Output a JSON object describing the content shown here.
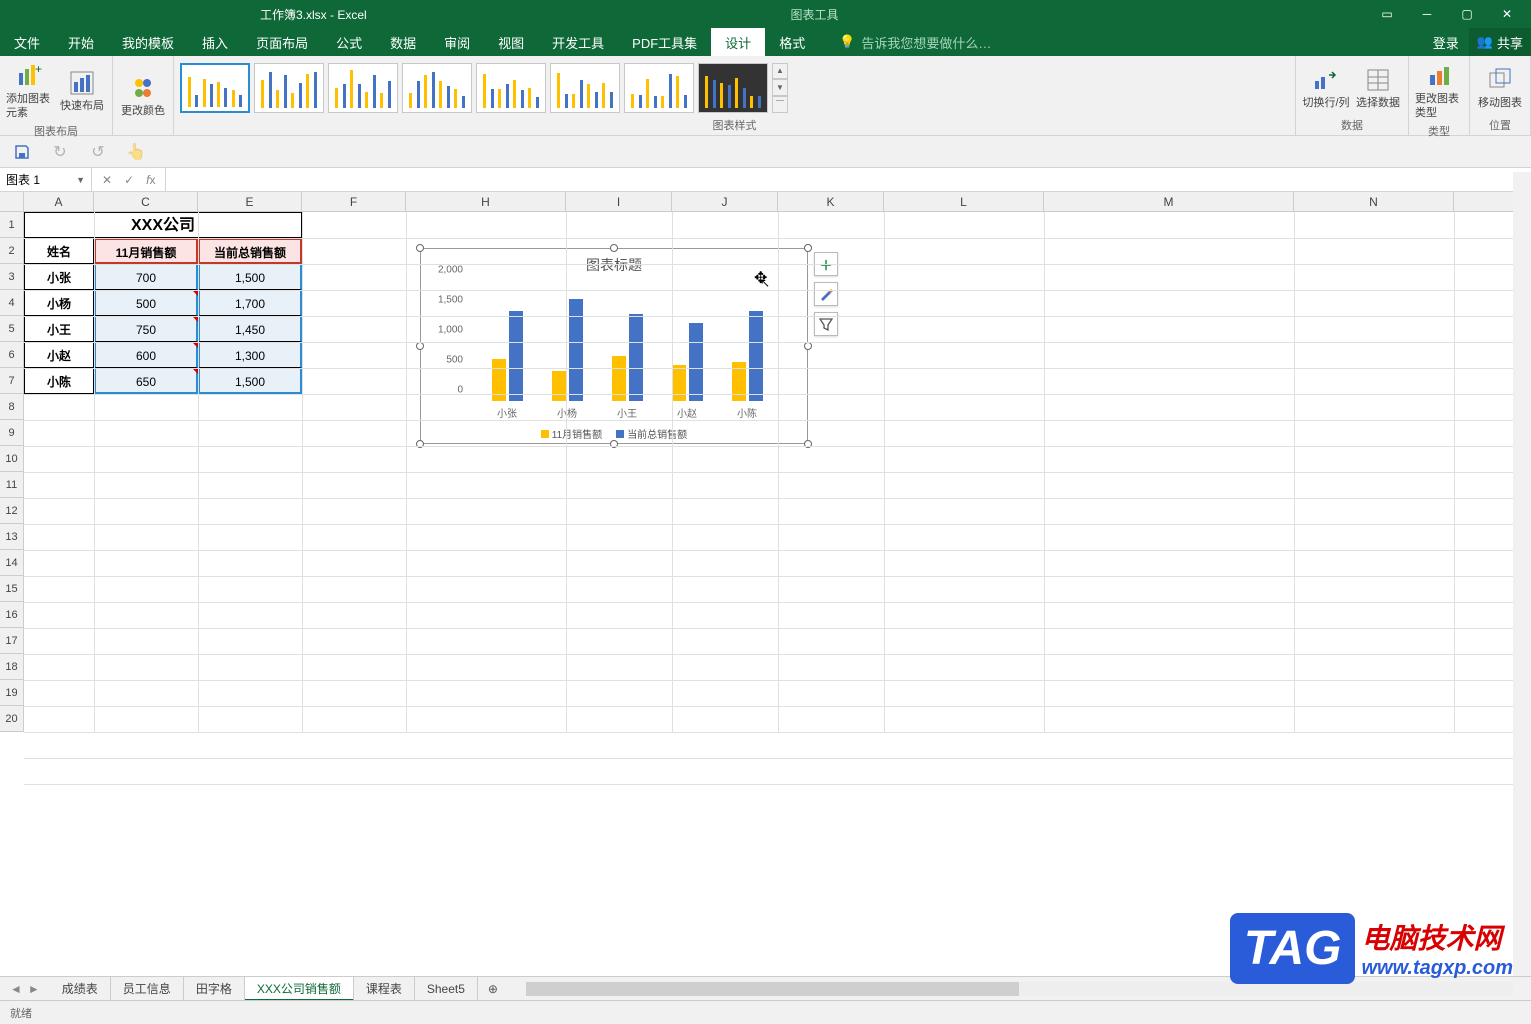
{
  "window": {
    "title": "工作簿3.xlsx - Excel",
    "contextual_tab": "图表工具",
    "login": "登录",
    "share": "共享"
  },
  "tabs": {
    "file": "文件",
    "home": "开始",
    "mytpl": "我的模板",
    "insert": "插入",
    "layout": "页面布局",
    "formula": "公式",
    "data": "数据",
    "review": "审阅",
    "view": "视图",
    "dev": "开发工具",
    "pdf": "PDF工具集",
    "design": "设计",
    "format": "格式",
    "tellme": "告诉我您想要做什么…"
  },
  "ribbon": {
    "layout_group": "图表布局",
    "add_element": "添加图表元素",
    "quick_layout": "快速布局",
    "change_color": "更改颜色",
    "styles_group": "图表样式",
    "switch_rc": "切换行/列",
    "select_data": "选择数据",
    "data_group": "数据",
    "change_type": "更改图表类型",
    "type_group": "类型",
    "move_chart": "移动图表",
    "loc_group": "位置"
  },
  "namebox": {
    "value": "图表 1"
  },
  "spreadsheet": {
    "columns": [
      "A",
      "C",
      "E",
      "F",
      "H",
      "I",
      "J",
      "K",
      "L",
      "M",
      "N"
    ],
    "company": "XXX公司",
    "headers": {
      "name": "姓名",
      "nov": "11月销售额",
      "total": "当前总销售额"
    },
    "rows": [
      {
        "name": "小张",
        "nov": "700",
        "total": "1,500"
      },
      {
        "name": "小杨",
        "nov": "500",
        "total": "1,700"
      },
      {
        "name": "小王",
        "nov": "750",
        "total": "1,450"
      },
      {
        "name": "小赵",
        "nov": "600",
        "total": "1,300"
      },
      {
        "name": "小陈",
        "nov": "650",
        "total": "1,500"
      }
    ]
  },
  "chart_data": {
    "type": "bar",
    "title": "图表标题",
    "categories": [
      "小张",
      "小杨",
      "小王",
      "小赵",
      "小陈"
    ],
    "series": [
      {
        "name": "11月销售额",
        "color": "#ffc000",
        "values": [
          700,
          500,
          750,
          600,
          650
        ]
      },
      {
        "name": "当前总销售额",
        "color": "#4472c4",
        "values": [
          1500,
          1700,
          1450,
          1300,
          1500
        ]
      }
    ],
    "ylim": [
      0,
      2000
    ],
    "yticks": [
      0,
      500,
      1000,
      1500,
      2000
    ],
    "xlabel": "",
    "ylabel": ""
  },
  "sheets": {
    "items": [
      "成绩表",
      "员工信息",
      "田字格",
      "XXX公司销售额",
      "课程表",
      "Sheet5"
    ],
    "active_index": 3
  },
  "statusbar": {
    "text": "就绪"
  },
  "watermark": {
    "tag": "TAG",
    "line1": "电脑技术网",
    "line2": "www.tagxp.com"
  }
}
